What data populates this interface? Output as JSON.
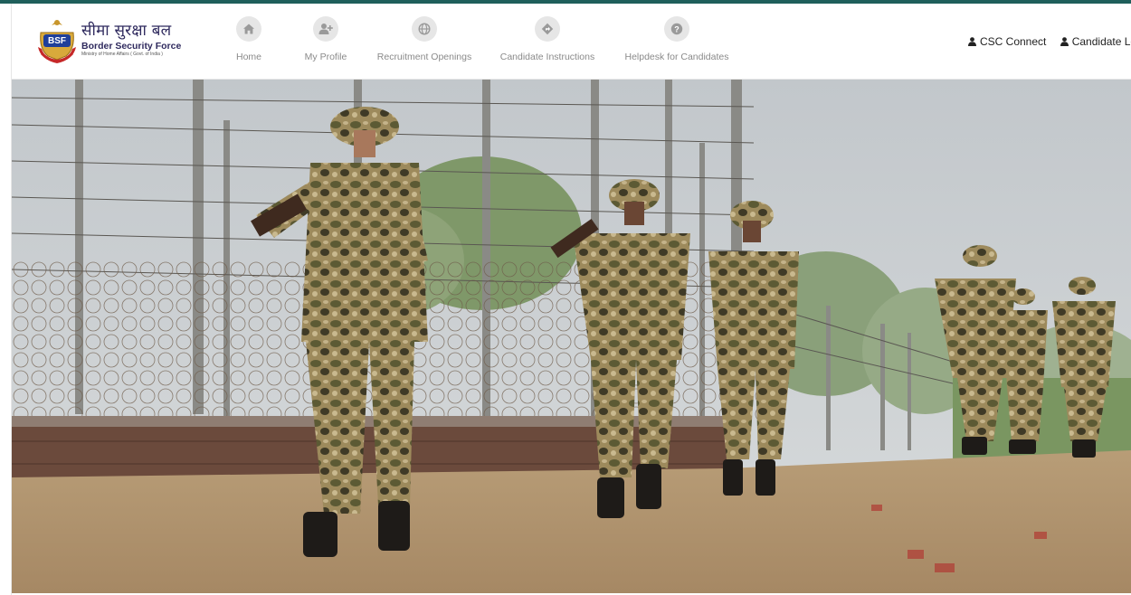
{
  "brand": {
    "hindi_title": "सीमा सुरक्षा बल",
    "english_title": "Border Security Force",
    "subtitle": "Ministry of Home Affairs ( Govt. of India )",
    "logo_text": "BSF"
  },
  "nav": {
    "items": [
      {
        "label": "Home",
        "icon": "home-icon"
      },
      {
        "label": "My Profile",
        "icon": "user-plus-icon"
      },
      {
        "label": "Recruitment Openings",
        "icon": "globe-icon"
      },
      {
        "label": "Candidate Instructions",
        "icon": "direction-sign-icon"
      },
      {
        "label": "Helpdesk for Candidates",
        "icon": "question-circle-icon"
      }
    ]
  },
  "header_links": {
    "csc_connect": "CSC Connect",
    "candidate_login": "Candidate Login"
  },
  "colors": {
    "top_strip": "#1f5f5b",
    "brand_text": "#2f2a5e",
    "nav_label": "#8a8a8a",
    "nav_icon_bg": "#e6e6e6"
  },
  "hero": {
    "image": "hero-banner-soldiers-patrolling-border-fence"
  }
}
